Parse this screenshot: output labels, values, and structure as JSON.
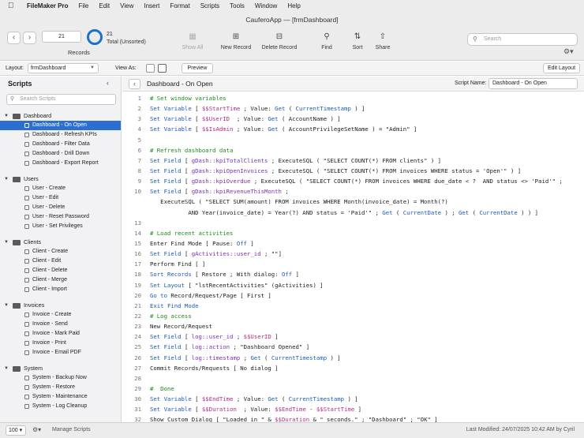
{
  "menubar": {
    "app_name": "FileMaker Pro",
    "items": [
      "File",
      "Edit",
      "View",
      "Insert",
      "Format",
      "Scripts",
      "Tools",
      "Window",
      "Help"
    ]
  },
  "window": {
    "title": "CauferoApp — [frmDashboard]"
  },
  "toolbar": {
    "record_number": "21",
    "records_label": "Records",
    "total_count": "21",
    "total_label": "Total (Unsorted)",
    "show_all": "Show All",
    "new_record": "New Record",
    "delete_record": "Delete Record",
    "find": "Find",
    "sort": "Sort",
    "share": "Share",
    "search_placeholder": "Search"
  },
  "layoutbar": {
    "layout_label": "Layout:",
    "layout_value": "frmDashboard",
    "view_as_label": "View As:",
    "preview_label": "Preview",
    "edit_layout_label": "Edit Layout"
  },
  "sidebar": {
    "title": "Scripts",
    "search_placeholder": "Search Scripts",
    "folders": [
      {
        "name": "Dashboard",
        "items": [
          "Dashboard - On Open",
          "Dashboard - Refresh KPIs",
          "Dashboard - Filter Data",
          "Dashboard - Drill Down",
          "Dashboard - Export Report"
        ]
      },
      {
        "name": "Users",
        "items": [
          "User - Create",
          "User - Edit",
          "User - Delete",
          "User - Reset Password",
          "User - Set Privileges"
        ]
      },
      {
        "name": "Clients",
        "items": [
          "Client - Create",
          "Client - Edit",
          "Client - Delete",
          "Client - Merge",
          "Client - Import"
        ]
      },
      {
        "name": "Invoices",
        "items": [
          "Invoice - Create",
          "Invoice - Send",
          "Invoice - Mark Paid",
          "Invoice - Print",
          "Invoice - Email PDF"
        ]
      },
      {
        "name": "System",
        "items": [
          "System - Backup Now",
          "System - Restore",
          "System - Maintenance",
          "System - Log Cleanup"
        ]
      }
    ],
    "selected": "Dashboard - On Open"
  },
  "editor": {
    "title": "Dashboard - On Open",
    "script_name_label": "Script Name:",
    "script_name_value": "Dashboard - On Open",
    "lines": [
      [
        [
          "cmt",
          "# Set window variables"
        ]
      ],
      [
        [
          "kw",
          "Set Variable"
        ],
        [
          "",
          " [ "
        ],
        [
          "var",
          "$$StartTime"
        ],
        [
          "",
          " ; Value: "
        ],
        [
          "kw",
          "Get"
        ],
        [
          "",
          " ( "
        ],
        [
          "fn",
          "CurrentTimestamp"
        ],
        [
          "",
          " ) ]"
        ]
      ],
      [
        [
          "kw",
          "Set Variable"
        ],
        [
          "",
          " [ "
        ],
        [
          "var",
          "$$UserID"
        ],
        [
          "",
          "  ; Value: "
        ],
        [
          "kw",
          "Get"
        ],
        [
          "",
          " ( AccountName ) ]"
        ]
      ],
      [
        [
          "kw",
          "Set Variable"
        ],
        [
          "",
          " [ "
        ],
        [
          "var",
          "$$IsAdmin"
        ],
        [
          "",
          " ; Value: "
        ],
        [
          "kw",
          "Get"
        ],
        [
          "",
          " ( AccountPrivilegeSetName ) = \"Admin\" ]"
        ]
      ],
      [
        [
          "",
          ""
        ]
      ],
      [
        [
          "cmt",
          "# Refresh dashboard data"
        ]
      ],
      [
        [
          "kw",
          "Set Field"
        ],
        [
          "",
          " [ "
        ],
        [
          "fld",
          "gDash::kpiTotalClients"
        ],
        [
          "",
          " ; ExecuteSQL ( \"SELECT COUNT(*) FROM clients\" ) ]"
        ]
      ],
      [
        [
          "kw",
          "Set Field"
        ],
        [
          "",
          " [ "
        ],
        [
          "fld",
          "gDash::kpiOpenInvoices"
        ],
        [
          "",
          " ; ExecuteSQL ( \"SELECT COUNT(*) FROM invoices WHERE status = 'Open'\" ) ]"
        ]
      ],
      [
        [
          "kw",
          "Set Field"
        ],
        [
          "",
          " [ "
        ],
        [
          "fld",
          "gDash::kpiOverdue"
        ],
        [
          "",
          " ; ExecuteSQL ( \"SELECT COUNT(*) FROM invoices WHERE due_date < ?  AND status <> 'Paid'\" ; "
        ]
      ],
      [
        [
          "kw",
          "Set Field"
        ],
        [
          "",
          " [ "
        ],
        [
          "fld",
          "gDash::kpiRevenueThisMonth"
        ],
        [
          "",
          " ;"
        ]
      ],
      [
        [
          "",
          "   ExecuteSQL ( \"SELECT SUM(amount) FROM invoices WHERE Month(invoice_date) = Month(?)"
        ]
      ],
      [
        [
          "",
          "           AND Year(invoice_date) = Year(?) AND status = 'Paid'\" ; "
        ],
        [
          "kw",
          "Get"
        ],
        [
          "",
          " ( "
        ],
        [
          "fn",
          "CurrentDate"
        ],
        [
          "",
          " ) ; "
        ],
        [
          "kw",
          "Get"
        ],
        [
          "",
          " ( "
        ],
        [
          "fn",
          "CurrentDate"
        ],
        [
          "",
          " ) ) ]"
        ]
      ],
      [
        [
          "",
          ""
        ]
      ],
      [
        [
          "cmt",
          "# Load recent activities"
        ]
      ],
      [
        [
          "",
          "Enter Find Mode [ Pause: "
        ],
        [
          "kw",
          "Off"
        ],
        [
          "",
          " ]"
        ]
      ],
      [
        [
          "kw",
          "Set Field"
        ],
        [
          "",
          " [ "
        ],
        [
          "fld",
          "gActivities::user_id"
        ],
        [
          "",
          " ; \"\"]"
        ]
      ],
      [
        [
          "",
          "Perform Find [ ]"
        ]
      ],
      [
        [
          "kw",
          "Sort Records"
        ],
        [
          "",
          " [ Restore ; With dialog: "
        ],
        [
          "kw",
          "Off"
        ],
        [
          "",
          " ]"
        ]
      ],
      [
        [
          "kw",
          "Set Layout"
        ],
        [
          "",
          " [ \"lstRecentActivities\" (gActivities) ]"
        ]
      ],
      [
        [
          "kw",
          "Go to"
        ],
        [
          "",
          " Record/Request/Page [ First ]"
        ]
      ],
      [
        [
          "kw",
          "Exit Find Mode"
        ]
      ],
      [
        [
          "cmt",
          "# Log access"
        ]
      ],
      [
        [
          "",
          "New Record/Request"
        ]
      ],
      [
        [
          "kw",
          "Set Field"
        ],
        [
          "",
          " [ "
        ],
        [
          "fld",
          "log::user_id"
        ],
        [
          "",
          " ; "
        ],
        [
          "var",
          "$$UserID"
        ],
        [
          "",
          " ]"
        ]
      ],
      [
        [
          "kw",
          "Set Field"
        ],
        [
          "",
          " [ "
        ],
        [
          "fld",
          "log::action"
        ],
        [
          "",
          " ; \"Dashboard Opened\" ]"
        ]
      ],
      [
        [
          "kw",
          "Set Field"
        ],
        [
          "",
          " [ "
        ],
        [
          "fld",
          "log::timestamp"
        ],
        [
          "",
          " ; "
        ],
        [
          "kw",
          "Get"
        ],
        [
          "",
          " ( "
        ],
        [
          "fn",
          "CurrentTimestamp"
        ],
        [
          "",
          " ) ]"
        ]
      ],
      [
        [
          "",
          "Commit Records/Requests [ No dialog ]"
        ]
      ],
      [
        [
          "",
          ""
        ]
      ],
      [
        [
          "cmt",
          "#  Done"
        ]
      ],
      [
        [
          "kw",
          "Set Variable"
        ],
        [
          "",
          " [ "
        ],
        [
          "var",
          "$$EndTime"
        ],
        [
          "",
          " ; Value: "
        ],
        [
          "kw",
          "Get"
        ],
        [
          "",
          " ( "
        ],
        [
          "fn",
          "CurrentTimestamp"
        ],
        [
          "",
          " ) ]"
        ]
      ],
      [
        [
          "kw",
          "Set Variable"
        ],
        [
          "",
          " [ "
        ],
        [
          "var",
          "$$Duration"
        ],
        [
          "",
          "  ; Value: "
        ],
        [
          "var",
          "$$EndTime"
        ],
        [
          "",
          " - "
        ],
        [
          "var",
          "$$StartTime"
        ],
        [
          "",
          " ]"
        ]
      ],
      [
        [
          "",
          "Show Custom Dialog [ \"Loaded in \" & "
        ],
        [
          "var",
          "$$Duration"
        ],
        [
          "",
          " & \" seconds.\" ; \"Dashboard\" ; \"OK\" ]"
        ]
      ]
    ],
    "line_numbers": [
      "1",
      "2",
      "3",
      "4",
      "5",
      "6",
      "7",
      "8",
      "9",
      "10",
      "",
      "",
      "13",
      "14",
      "15",
      "16",
      "17",
      "18",
      "19",
      "20",
      "21",
      "22",
      "23",
      "24",
      "25",
      "26",
      "27",
      "28",
      "29",
      "30",
      "31",
      "32"
    ]
  },
  "bottombar": {
    "zoom": "100",
    "manage_scripts": "Manage Scripts",
    "last_modified": "Last Modified: 24/07/2025 10:42 AM by Cyril"
  },
  "colors": {
    "selection": "#2b6fd3",
    "keyword": "#1c5ab8",
    "comment": "#1a8c1a",
    "variable": "#b02a8a"
  }
}
